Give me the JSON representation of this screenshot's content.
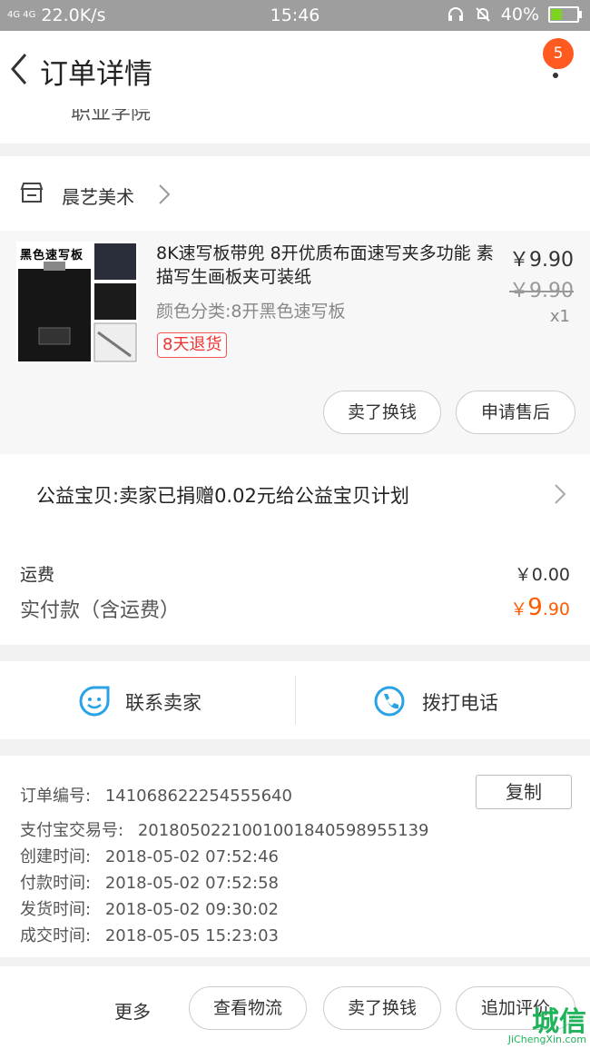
{
  "status": {
    "net_type": "4G 4G",
    "speed": "22.0K/s",
    "time": "15:46",
    "battery": "40%",
    "battery_level": 0.4
  },
  "nav": {
    "title": "订单详情",
    "badge_count": "5"
  },
  "address_tail": "职业学院",
  "shop": {
    "name": "晨艺美术"
  },
  "item": {
    "title": "8K速写板带兜 8开优质布面速写夹多功能 素描写生画板夹可装纸",
    "sku": "颜色分类:8开黑色速写板",
    "tag": "8天退货",
    "price": "￥9.90",
    "original_price": "￥9.90",
    "quantity": "x1",
    "thumb_text": "黑色速写板",
    "buttons": [
      "卖了换钱",
      "申请售后"
    ]
  },
  "charity": {
    "text": "公益宝贝:卖家已捐赠0.02元给公益宝贝计划"
  },
  "costs": {
    "shipping_label": "运费",
    "shipping_value": "￥0.00",
    "paid_label": "实付款（含运费）",
    "paid_symbol": "￥",
    "paid_int": "9",
    "paid_dec": ".90"
  },
  "contact": {
    "seller": "联系卖家",
    "phone": "拨打电话"
  },
  "info": {
    "order_no_label": "订单编号:",
    "order_no": "141068622254555640",
    "copy": "复制",
    "alipay_label": "支付宝交易号:",
    "alipay_no": "2018050221001001840598955139",
    "created_label": "创建时间:",
    "created": "2018-05-02 07:52:46",
    "paid_label": "付款时间:",
    "paid": "2018-05-02 07:52:58",
    "shipped_label": "发货时间:",
    "shipped": "2018-05-02 09:30:02",
    "done_label": "成交时间:",
    "done": "2018-05-05 15:23:03"
  },
  "bottom": {
    "more": "更多",
    "logistics": "查看物流",
    "sell": "卖了换钱",
    "review": "追加评价"
  },
  "watermark": {
    "brand": "城信",
    "url": "JiChengXin.com"
  },
  "colors": {
    "accent_orange": "#ff5a00",
    "badge": "#ff5a1f",
    "icon_blue": "#2aa3e6"
  }
}
